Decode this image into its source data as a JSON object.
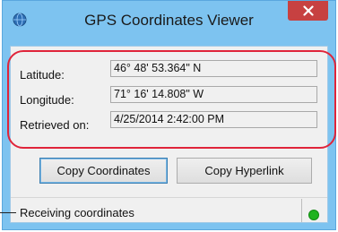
{
  "window": {
    "title": "GPS Coordinates Viewer",
    "icons": {
      "app": "globe-icon",
      "close": "close-icon"
    }
  },
  "fields": [
    {
      "label": "Latitude:",
      "value": "46° 48' 53.364\" N"
    },
    {
      "label": "Longitude:",
      "value": "71° 16' 14.808\" W"
    },
    {
      "label": "Retrieved on:",
      "value": "4/25/2014 2:42:00 PM"
    }
  ],
  "buttons": {
    "copy_coordinates": "Copy Coordinates",
    "copy_hyperlink": "Copy Hyperlink"
  },
  "status": {
    "text": "Receiving coordinates",
    "indicator_color": "#1fb31f"
  },
  "colors": {
    "frame": "#7dc3f0",
    "close_button": "#c74141",
    "callout": "#e0243a"
  }
}
